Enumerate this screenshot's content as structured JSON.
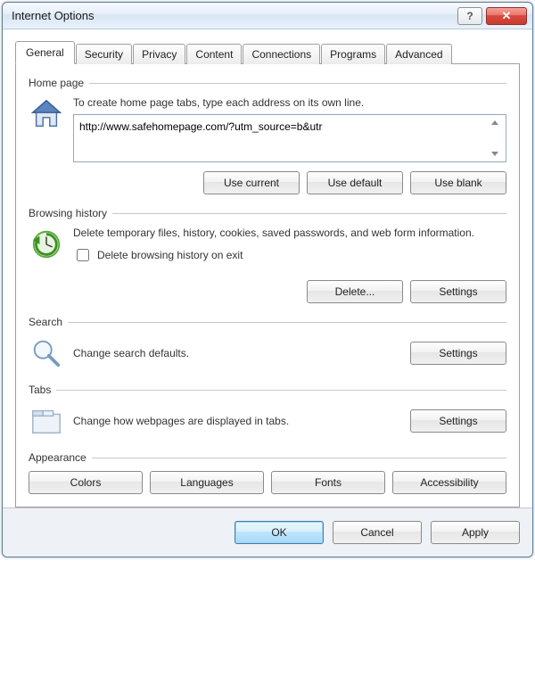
{
  "window": {
    "title": "Internet Options",
    "help_label": "?",
    "close_label": "✕"
  },
  "tabs": [
    {
      "label": "General",
      "active": true
    },
    {
      "label": "Security",
      "active": false
    },
    {
      "label": "Privacy",
      "active": false
    },
    {
      "label": "Content",
      "active": false
    },
    {
      "label": "Connections",
      "active": false
    },
    {
      "label": "Programs",
      "active": false
    },
    {
      "label": "Advanced",
      "active": false
    }
  ],
  "homepage": {
    "group_title": "Home page",
    "description": "To create home page tabs, type each address on its own line.",
    "value": "http://www.safehomepage.com/?utm_source=b&utr",
    "use_current": "Use current",
    "use_default": "Use default",
    "use_blank": "Use blank"
  },
  "history": {
    "group_title": "Browsing history",
    "description": "Delete temporary files, history, cookies, saved passwords, and web form information.",
    "checkbox_label": "Delete browsing history on exit",
    "checkbox_checked": false,
    "delete": "Delete...",
    "settings": "Settings"
  },
  "search": {
    "group_title": "Search",
    "description": "Change search defaults.",
    "settings": "Settings"
  },
  "tabs_section": {
    "group_title": "Tabs",
    "description": "Change how webpages are displayed in tabs.",
    "settings": "Settings"
  },
  "appearance": {
    "group_title": "Appearance",
    "colors": "Colors",
    "languages": "Languages",
    "fonts": "Fonts",
    "accessibility": "Accessibility"
  },
  "footer": {
    "ok": "OK",
    "cancel": "Cancel",
    "apply": "Apply"
  }
}
